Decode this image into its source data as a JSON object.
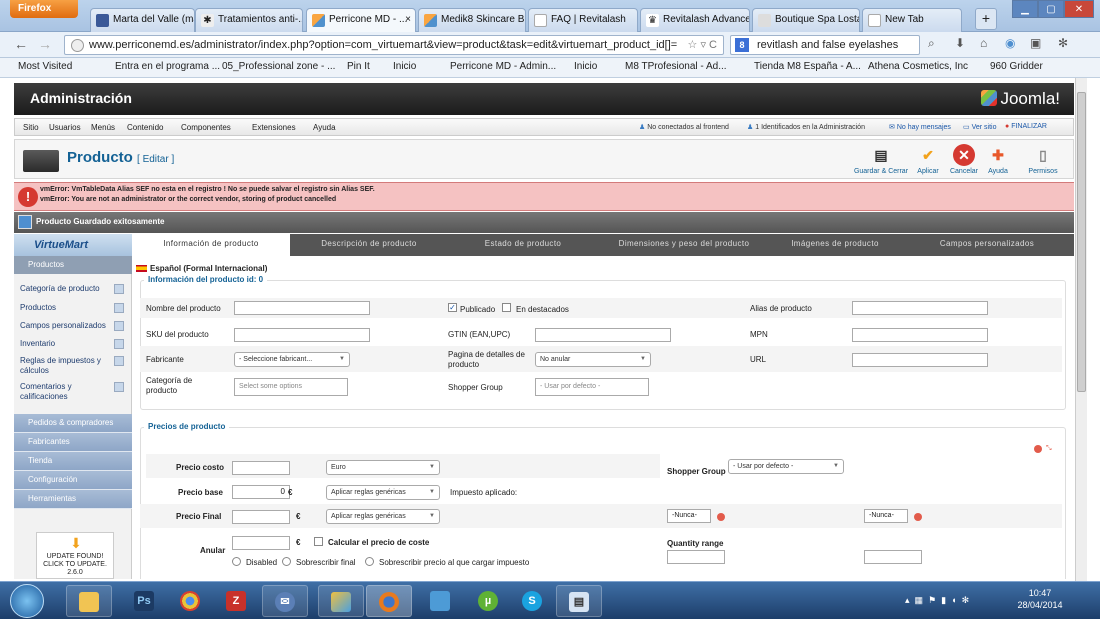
{
  "browser": {
    "app_button": "Firefox",
    "tabs": [
      {
        "label": "Marta del Valle (ma...",
        "color": "#3b5998"
      },
      {
        "label": "Tratamientos anti-...",
        "color": "#222222"
      },
      {
        "label": "Perricone MD - ...",
        "color": "#f2a21c",
        "active": true
      },
      {
        "label": "Medik8 Skincare Bi...",
        "color": "#f2a21c"
      },
      {
        "label": "FAQ | Revitalash",
        "color": "#ffffff"
      },
      {
        "label": "Revitalash Advance...",
        "color": "#222222"
      },
      {
        "label": "Boutique Spa Losta...",
        "color": "#dddddd"
      },
      {
        "label": "New Tab",
        "color": "#ffffff"
      }
    ],
    "url": "www.perriconemd.es/administrator/index.php?option=com_virtuemart&view=product&task=edit&virtuemart_product_id[]=",
    "search_value": "revitlash and false eyelashes",
    "bookmarks": [
      "Most Visited",
      "Entra en el programa ...",
      "05_Professional zone - ...",
      "Pin It",
      "Inicio",
      "Perricone MD - Admin...",
      "Inicio",
      "M8 TProfesional - Ad...",
      "Tienda M8 España - A...",
      "Athena Cosmetics, Inc",
      "960 Gridder"
    ]
  },
  "admin": {
    "title": "Administración",
    "logo_text": "Joomla!",
    "menu": [
      "Sitio",
      "Usuarios",
      "Menús",
      "Contenido",
      "Componentes",
      "Extensiones",
      "Ayuda"
    ],
    "status": {
      "frontend": "No conectados al frontend",
      "backend": "1 Identificados en la Administración",
      "messages": "No hay mensajes",
      "view_site": "Ver sitio",
      "logout": "FINALIZAR"
    },
    "page_title": "Producto",
    "page_subtitle": "[ Editar ]",
    "toolbar": [
      {
        "label": "Guardar & Cerrar",
        "icon": "save-close-icon",
        "glyph": "▤",
        "color": "#333333"
      },
      {
        "label": "Aplicar",
        "icon": "apply-icon",
        "glyph": "✔",
        "color": "#f2a21c"
      },
      {
        "label": "Cancelar",
        "icon": "cancel-icon",
        "glyph": "✕",
        "color": "#d53931"
      },
      {
        "label": "Ayuda",
        "icon": "help-icon",
        "glyph": "✚",
        "color": "#e8582a"
      },
      {
        "label": "Permisos",
        "icon": "permissions-icon",
        "glyph": "▯",
        "color": "#888888"
      }
    ],
    "errors": [
      "vmError: VmTableData Alias SEF no esta en el registro ! No se puede salvar el registro sin Alias SEF.",
      "vmError: You are not an administrator or the correct vendor, storing of product cancelled"
    ],
    "saved_message": "Producto Guardado exitosamente"
  },
  "sidebar": {
    "logo": "VirtueMart",
    "active_section": "Productos",
    "items": [
      "Categoría de producto",
      "Productos",
      "Campos personalizados",
      "Inventario",
      "Reglas de impuestos y cálculos",
      "Comentarios y calificaciones"
    ],
    "sections": [
      "Pedidos & compradores",
      "Fabricantes",
      "Tienda",
      "Configuración",
      "Herramientas"
    ],
    "update": {
      "line1": "UPDATE FOUND!",
      "line2": "CLICK TO UPDATE.",
      "version": "2.6.0"
    }
  },
  "tabs": [
    "Información de producto",
    "Descripción de producto",
    "Estado de producto",
    "Dimensiones y peso del producto",
    "Imágenes de producto",
    "Campos personalizados"
  ],
  "form": {
    "language": "Español (Formal Internacional)",
    "info_legend": "Información del producto id: 0",
    "product_name_label": "Nombre del producto",
    "published_label": "Publicado",
    "featured_label": "En destacados",
    "alias_label": "Alias de producto",
    "sku_label": "SKU del producto",
    "gtin_label": "GTIN (EAN,UPC)",
    "mpn_label": "MPN",
    "manufacturer_label": "Fabricante",
    "manufacturer_value": "- Seleccione fabricant...",
    "detail_page_label": "Pagina de detalles de producto",
    "detail_page_value": "No anular",
    "url_label": "URL",
    "category_label": "Categoría de producto",
    "category_placeholder": "Select some options",
    "shopper_group_label": "Shopper Group",
    "shopper_group_placeholder": "- Usar por defecto -"
  },
  "prices": {
    "legend": "Precios de producto",
    "cost_label": "Precio costo",
    "currency": "Euro",
    "shopper_group_label": "Shopper Group",
    "shopper_group_value": "- Usar por defecto -",
    "base_label": "Precio base",
    "base_value": "0",
    "currency_symbol": "€",
    "rules_value": "Aplicar reglas genéricas",
    "tax_applied": "Impuesto aplicado:",
    "final_label": "Precio Final",
    "never_1": "-Nunca-",
    "never_2": "-Nunca-",
    "override_label": "Anular",
    "calc_cost_label": "Calcular el precio de coste",
    "quantity_range": "Quantity range",
    "radio_disabled": "Disabled",
    "radio_override_final": "Sobrescribir final",
    "radio_override_tax": "Sobrescribir precio al que cargar impuesto"
  },
  "taskbar": {
    "apps": [
      "Windows Explorer",
      "Photoshop",
      "Chrome",
      "FileZilla",
      "Thunderbird",
      "Paint",
      "Firefox",
      "Control Panel",
      "uTorrent",
      "Skype",
      "Notepad"
    ],
    "time": "10:47",
    "date": "28/04/2014"
  }
}
